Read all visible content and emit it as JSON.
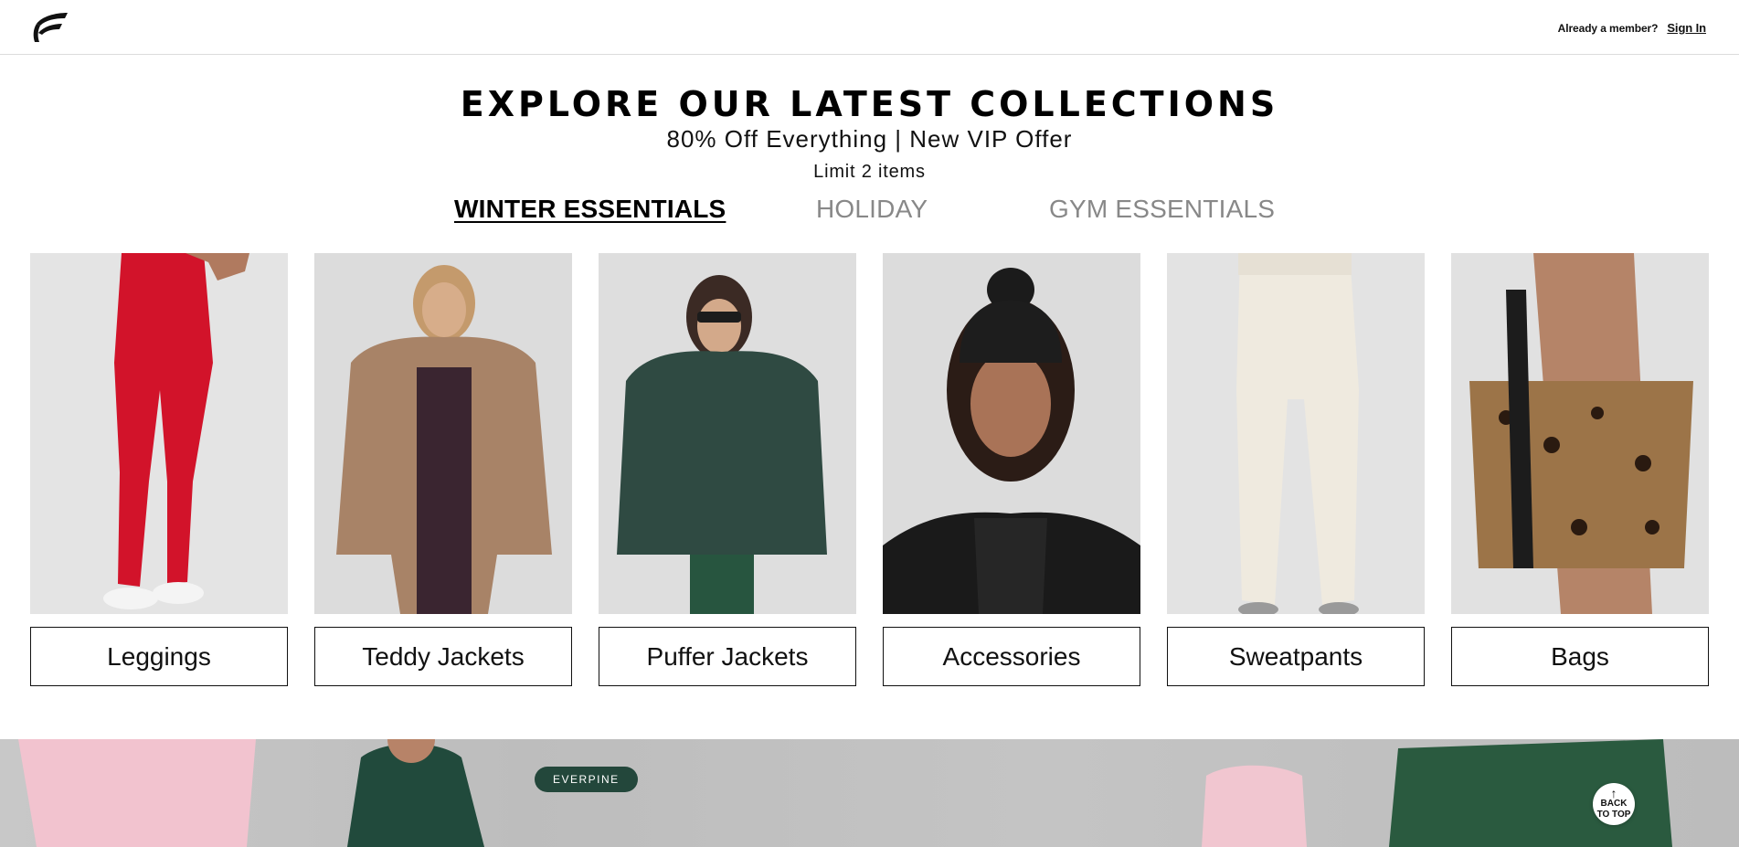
{
  "header": {
    "logo_icon": "brand-f-logo-icon",
    "member_question": "Already a member?",
    "sign_in_label": "Sign In"
  },
  "hero": {
    "headline": "EXPLORE OUR LATEST COLLECTIONS",
    "offer": "80% Off Everything | New VIP Offer",
    "limit": "Limit 2 items"
  },
  "tabs": [
    {
      "label": "WINTER ESSENTIALS",
      "active": true
    },
    {
      "label": "HOLIDAY",
      "active": false
    },
    {
      "label": "GYM ESSENTIALS",
      "active": false
    }
  ],
  "products": [
    {
      "label": "Leggings",
      "image": "red-leggings-photo"
    },
    {
      "label": "Teddy Jackets",
      "image": "teddy-jacket-photo"
    },
    {
      "label": "Puffer Jackets",
      "image": "puffer-jacket-photo"
    },
    {
      "label": "Accessories",
      "image": "beanie-photo"
    },
    {
      "label": "Sweatpants",
      "image": "sweatpants-photo"
    },
    {
      "label": "Bags",
      "image": "leopard-tote-photo"
    }
  ],
  "banner": {
    "badge": "EVERPINE",
    "back_to_top_line1": "BACK",
    "back_to_top_line2": "TO TOP"
  },
  "colors": {
    "accent_green": "#23473b",
    "tab_inactive": "#888888"
  }
}
